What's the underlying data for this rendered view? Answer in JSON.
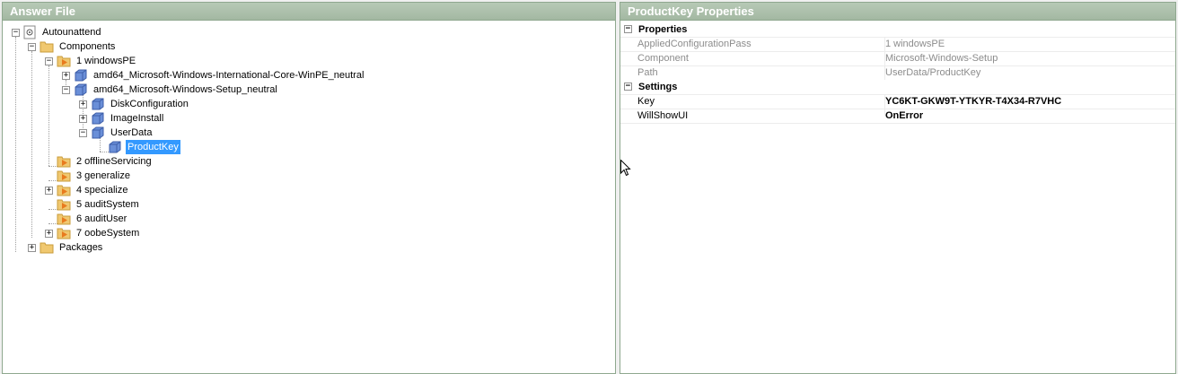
{
  "left_pane": {
    "title": "Answer File",
    "tree": [
      {
        "label": "Autounattend",
        "expander": "−",
        "icon": "answer-file-icon"
      },
      {
        "label": "Components",
        "expander": "−",
        "icon": "folder-icon"
      },
      {
        "label": "1 windowsPE",
        "expander": "−",
        "icon": "pass-icon"
      },
      {
        "label": "amd64_Microsoft-Windows-International-Core-WinPE_neutral",
        "expander": "+",
        "icon": "component-icon"
      },
      {
        "label": "amd64_Microsoft-Windows-Setup_neutral",
        "expander": "−",
        "icon": "component-icon"
      },
      {
        "label": "DiskConfiguration",
        "expander": "+",
        "icon": "component-icon"
      },
      {
        "label": "ImageInstall",
        "expander": "+",
        "icon": "component-icon"
      },
      {
        "label": "UserData",
        "expander": "−",
        "icon": "component-icon"
      },
      {
        "label": "ProductKey",
        "expander": "",
        "icon": "component-icon"
      },
      {
        "label": "2 offlineServicing",
        "expander": "",
        "icon": "pass-icon"
      },
      {
        "label": "3 generalize",
        "expander": "",
        "icon": "pass-icon"
      },
      {
        "label": "4 specialize",
        "expander": "+",
        "icon": "pass-icon"
      },
      {
        "label": "5 auditSystem",
        "expander": "",
        "icon": "pass-icon"
      },
      {
        "label": "6 auditUser",
        "expander": "",
        "icon": "pass-icon"
      },
      {
        "label": "7 oobeSystem",
        "expander": "+",
        "icon": "pass-icon"
      },
      {
        "label": "Packages",
        "expander": "+",
        "icon": "folder-icon"
      }
    ]
  },
  "right_pane": {
    "title": "ProductKey Properties",
    "categories": {
      "properties": {
        "label": "Properties",
        "expander": "−",
        "rows": [
          {
            "name": "AppliedConfigurationPass",
            "value": "1 windowsPE"
          },
          {
            "name": "Component",
            "value": "Microsoft-Windows-Setup"
          },
          {
            "name": "Path",
            "value": "UserData/ProductKey"
          }
        ]
      },
      "settings": {
        "label": "Settings",
        "expander": "−",
        "rows": [
          {
            "name": "Key",
            "value": "YC6KT-GKW9T-YTKYR-T4X34-R7VHC"
          },
          {
            "name": "WillShowUI",
            "value": "OnError"
          }
        ]
      }
    }
  },
  "colors": {
    "header_gradient": "#a3b8a2",
    "selection": "#3399ff",
    "folder": "#f0c870",
    "component": "#6a8fd8",
    "pass_arrow": "#e87b1e"
  }
}
